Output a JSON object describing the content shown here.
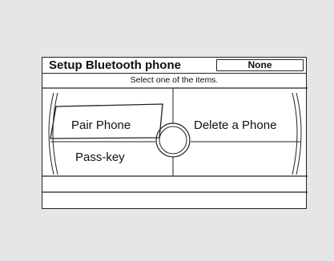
{
  "screen": {
    "title": "Setup Bluetooth phone",
    "status": "None",
    "instruction": "Select one of the items."
  },
  "menu": {
    "items": [
      {
        "label": "Pair Phone",
        "selected": true
      },
      {
        "label": "Delete a Phone",
        "selected": false
      },
      {
        "label": "Pass-key",
        "selected": false
      }
    ]
  }
}
